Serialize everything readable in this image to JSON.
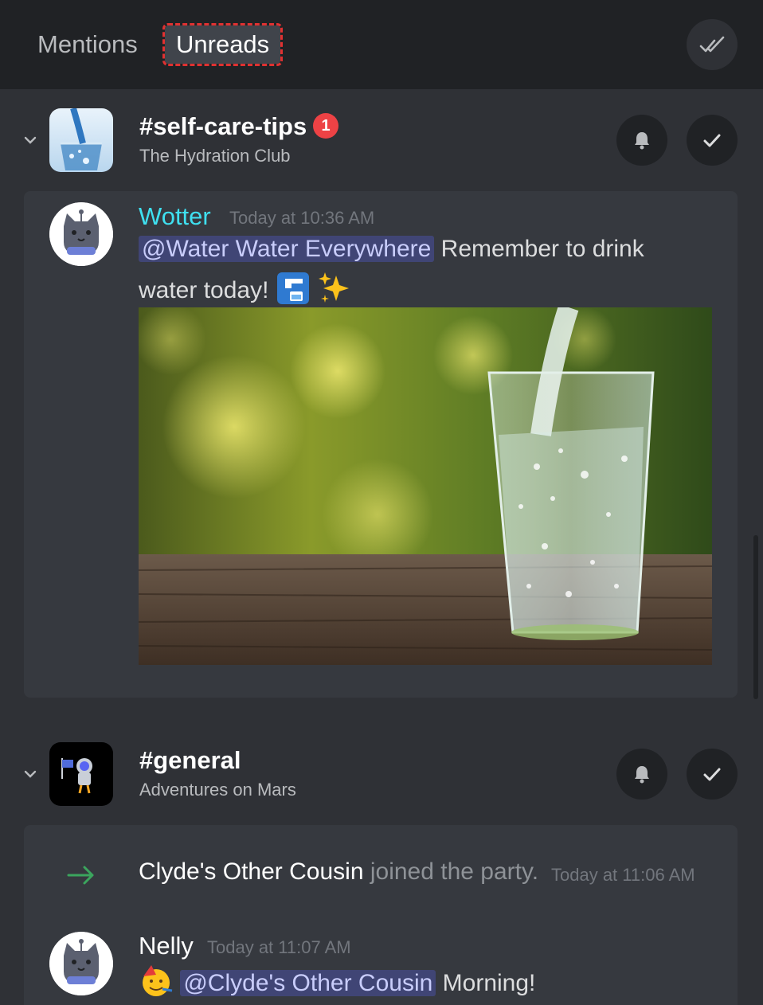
{
  "tabs": {
    "mentions": "Mentions",
    "unreads": "Unreads"
  },
  "mark_all_read_icon": "double-check-icon",
  "sections": [
    {
      "channel": "#self-care-tips",
      "guild": "The Hydration Club",
      "badge": "1",
      "messages": [
        {
          "author": "Wotter",
          "author_color": "#3fe0f0",
          "timestamp": "Today at 10:36 AM",
          "mention": "@Water Water Everywhere",
          "text_line1": " Remember to drink",
          "text_line2": "water today! ",
          "emojis": [
            "potable-water-icon",
            "sparkles-icon"
          ],
          "has_image": true
        }
      ]
    },
    {
      "channel": "#general",
      "guild": "Adventures on Mars",
      "system_message": {
        "user": "Clyde's Other Cousin",
        "text": " joined the party.",
        "timestamp": "Today at 11:06 AM"
      },
      "messages": [
        {
          "author": "Nelly",
          "author_color": "#ffffff",
          "timestamp": "Today at 11:07 AM",
          "mention": "@Clyde's Other Cousin",
          "text_line1": " Morning!",
          "emojis": [
            "partying-face-icon"
          ]
        }
      ]
    }
  ],
  "colors": {
    "background": "#2f3136",
    "header": "#202225",
    "card": "#36393f",
    "mention_bg": "#5865f2",
    "badge": "#ed4245",
    "join_arrow": "#3ba55d"
  }
}
